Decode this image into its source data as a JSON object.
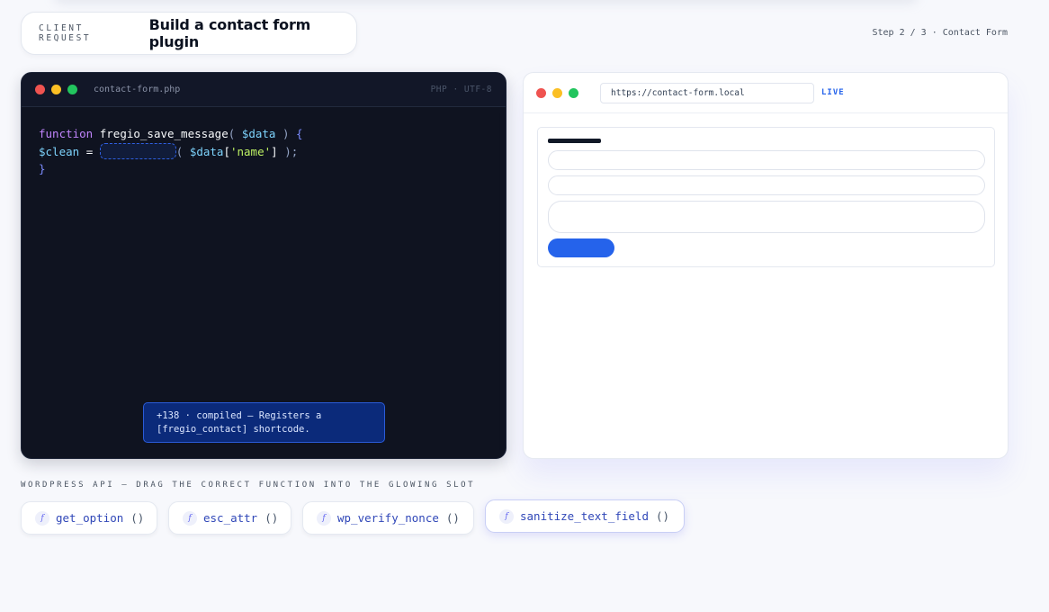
{
  "header": {
    "client_label": "CLIENT REQUEST",
    "title": "Build a contact form plugin",
    "step": "Step 2 / 3 · Contact Form"
  },
  "editor": {
    "filename": "contact-form.php",
    "lang": "PHP · UTF-8",
    "code": {
      "kw_function": "function",
      "fn_name": "fregio_save_message",
      "paren_open": "(",
      "param": "$data",
      "paren_close": ")",
      "brace_open": "{",
      "var_clean": "$clean",
      "assign": "=",
      "call_open": "(",
      "data_var": "$data",
      "bracket_open": "[",
      "key_str": "'name'",
      "bracket_close": "]",
      "call_close": ");",
      "brace_close": "}"
    },
    "toast": "+138 · compiled — Registers a [fregio_contact] shortcode."
  },
  "browser": {
    "url": "https://contact-form.local",
    "status": "LIVE"
  },
  "api": {
    "label": "WORDPRESS API — DRAG THE CORRECT FUNCTION INTO THE GLOWING SLOT",
    "badge": "f",
    "parens": "()",
    "functions": [
      {
        "name": "get_option"
      },
      {
        "name": "esc_attr"
      },
      {
        "name": "wp_verify_nonce"
      },
      {
        "name": "sanitize_text_field"
      }
    ]
  },
  "colors": {
    "accent": "#2563eb",
    "editor_bg": "#0f1320",
    "toast_bg": "#0b2a7a"
  }
}
